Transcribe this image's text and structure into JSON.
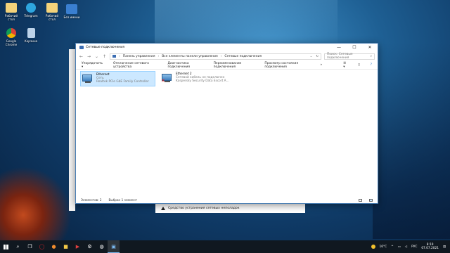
{
  "desktop": {
    "icons": [
      {
        "label": "Рабочий\nстол",
        "color": "#f3d27a"
      },
      {
        "label": "Telegram",
        "color": "#2ea6df"
      },
      {
        "label": "Рабочий\nстол",
        "color": "#f3d27a"
      },
      {
        "label": "Без имени",
        "color": "#3a7fd0"
      },
      {
        "label": "Google\nChrome",
        "color": "#e8e8e8"
      },
      {
        "label": "Корзина",
        "color": "#bcd3ea"
      }
    ]
  },
  "window": {
    "title": "Сетевые подключения",
    "controls": {
      "minimize": "—",
      "maximize": "☐",
      "close": "✕"
    },
    "breadcrumbs": [
      "Панель управления",
      "Все элементы панели управления",
      "Сетевые подключения"
    ],
    "search_placeholder": "Поиск: Сетевые подключения",
    "toolbar": {
      "organize": "Упорядочить",
      "disable": "Отключение сетевого устройства",
      "diagnose": "Диагностика подключения",
      "rename": "Переименование подключения",
      "status": "Просмотр состояния подключения"
    },
    "items": [
      {
        "name": "Ethernet",
        "line1": "Сеть",
        "line2": "Realtek PCIe GbE Family Controller"
      },
      {
        "name": "Ethernet 2",
        "line1": "Сетевой кабель не подключен",
        "line2": "Kaspersky Security Data Escort A..."
      }
    ],
    "status": {
      "count": "Элементов: 2",
      "selected": "Выбран 1 элемент"
    }
  },
  "behind_window": {
    "text": "Средство устранения сетевых неполадок"
  },
  "taskbar": {
    "weather": "16°C",
    "lang": "РУС",
    "time": "8:19",
    "date": "07.07.2021"
  }
}
